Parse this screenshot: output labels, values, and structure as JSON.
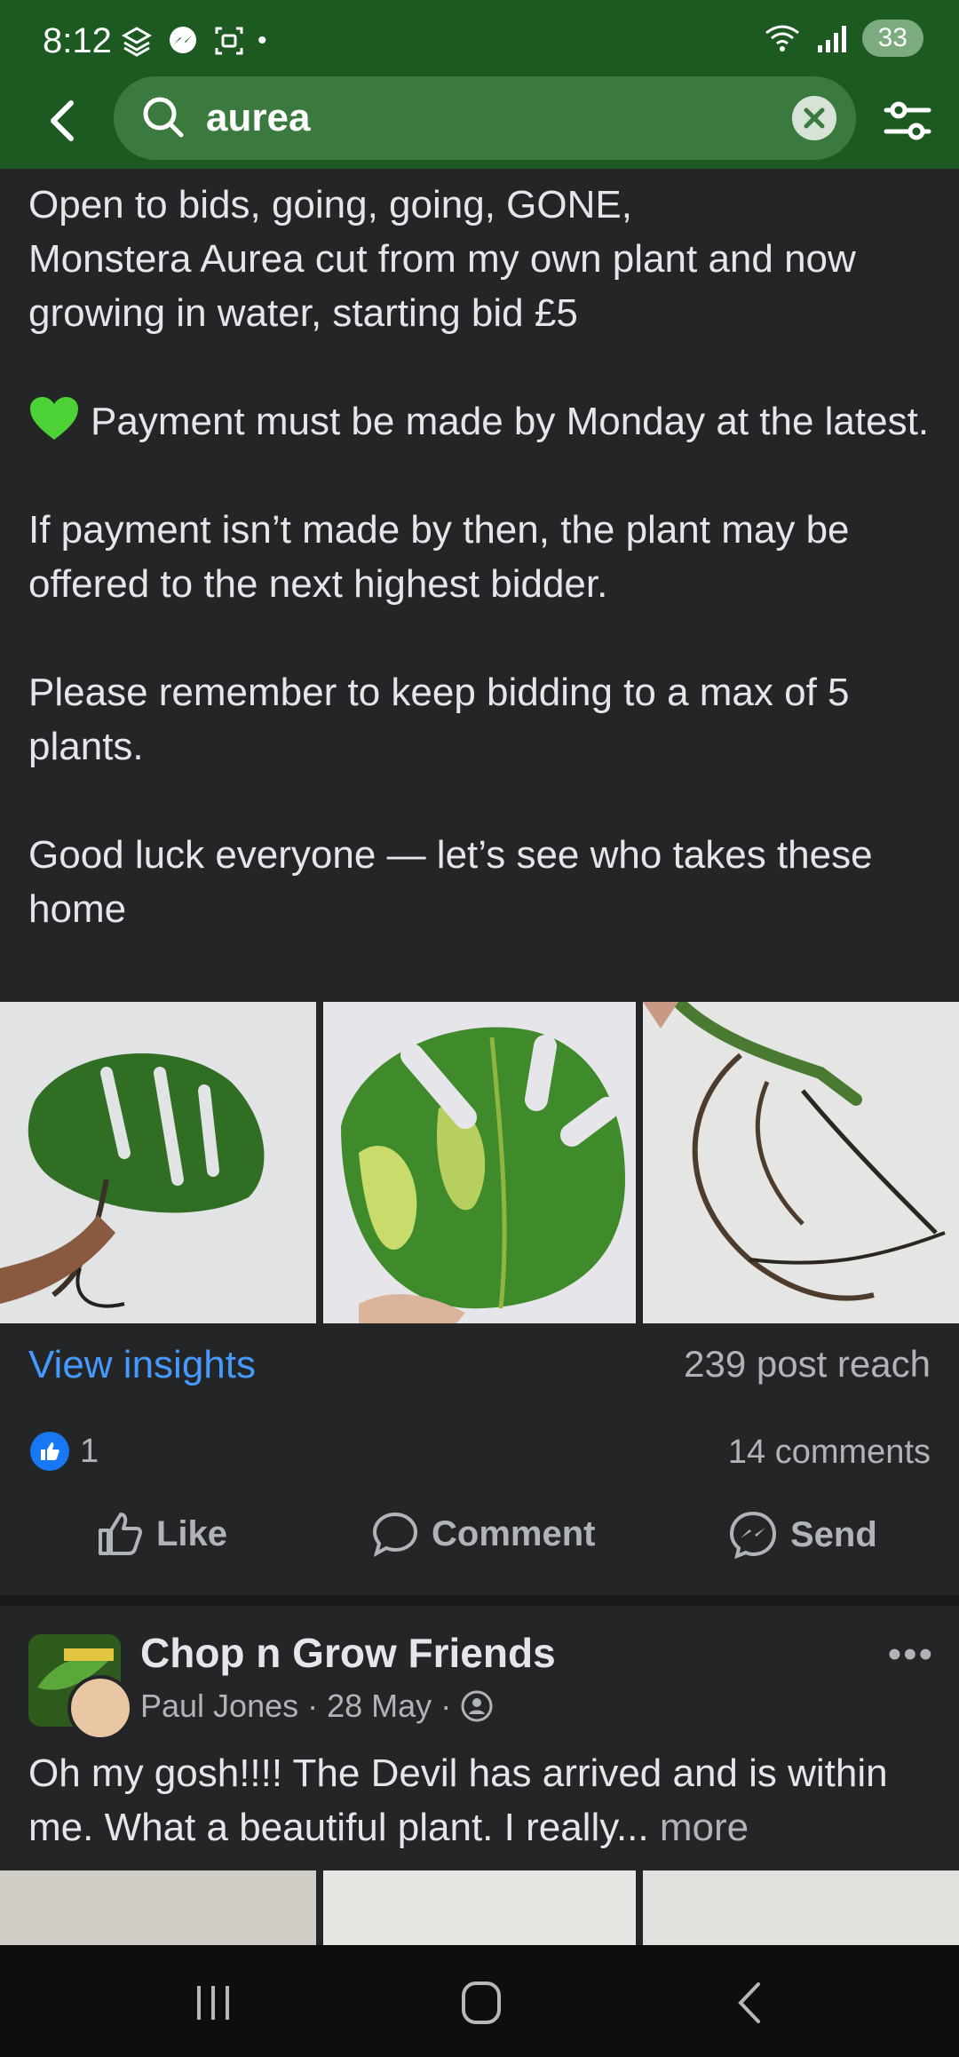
{
  "status": {
    "time": "8:12",
    "battery": "33"
  },
  "search": {
    "query": "aurea"
  },
  "post1": {
    "paragraphs": [
      "Open to bids, going, going, GONE,\nMonstera Aurea cut from my own plant and now growing in water, starting bid £5",
      "Payment must be made by Monday at the latest.",
      "If payment isn’t made by then, the plant may be offered to the next highest bidder.",
      "Please remember to keep bidding to a max of 5 plants.",
      "Good luck everyone — let’s see who takes these home"
    ],
    "insights_label": "View insights",
    "reach": "239 post reach",
    "likes": "1",
    "comments": "14 comments",
    "actions": {
      "like": "Like",
      "comment": "Comment",
      "send": "Send"
    }
  },
  "post2": {
    "group": "Chop n Grow Friends",
    "author": "Paul Jones",
    "date": "28 May",
    "text": "Oh my gosh!!!! The Devil has arrived and is within me. What a beautiful plant. I really...",
    "more": "more"
  },
  "colors": {
    "header": "#1d5a22",
    "search_field": "#3a7a3f",
    "link": "#4599ff",
    "background": "#242526"
  }
}
